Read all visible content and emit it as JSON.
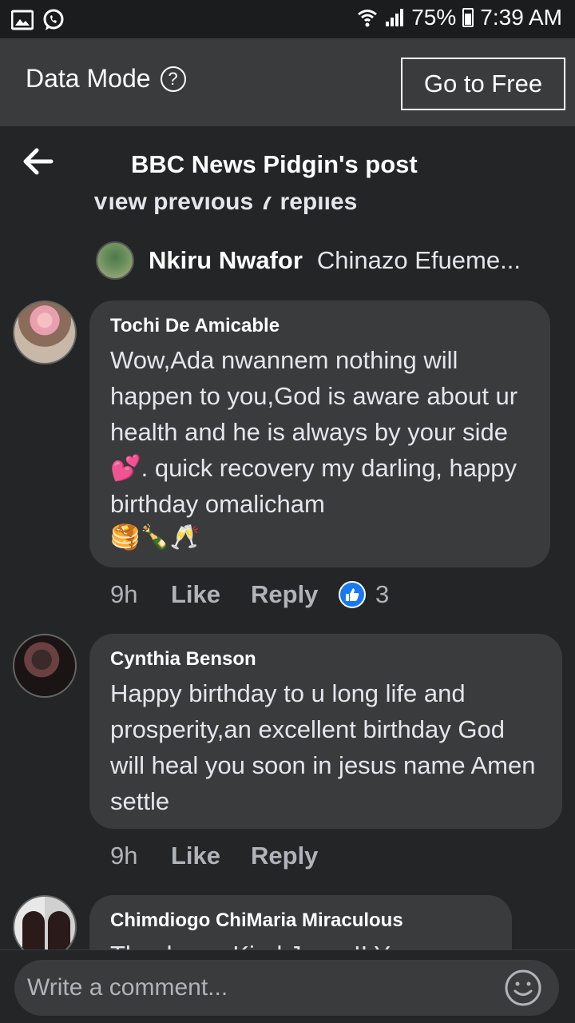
{
  "status_bar": {
    "battery": "75%",
    "time": "7:39 AM",
    "icons": [
      "image-icon",
      "whatsapp-icon",
      "wifi-icon",
      "signal-icon",
      "battery-icon"
    ]
  },
  "data_bar": {
    "label": "Data Mode",
    "help_glyph": "?",
    "go_free_label": "Go to Free"
  },
  "header": {
    "title": "BBC News Pidgin's post"
  },
  "thread": {
    "view_previous": "View previous 7 replies",
    "reply_preview": {
      "name": "Nkiru Nwafor",
      "text": "Chinazo Efueme..."
    }
  },
  "comments": [
    {
      "author": "Tochi De Amicable",
      "text": "Wow,Ada nwannem nothing will happen to you,God is aware about ur health and he is always by your side 💕. quick recovery my darling, happy birthday omalicham",
      "emojis": "🥞🍾🥂",
      "time": "9h",
      "like_label": "Like",
      "reply_label": "Reply",
      "reactions": "3"
    },
    {
      "author": "Cynthia Benson",
      "text": "Happy birthday to u long life and prosperity,an excellent birthday God will heal you soon in jesus name Amen settle",
      "time": "9h",
      "like_label": "Like",
      "reply_label": "Reply"
    },
    {
      "author": "Chimdiogo ChiMaria Miraculous",
      "text": "Thank you Kind Jesus!! You are"
    }
  ],
  "composer": {
    "placeholder": "Write a comment..."
  },
  "colors": {
    "background": "#242527",
    "bubble": "#3a3b3d",
    "like_blue": "#1877f2"
  }
}
